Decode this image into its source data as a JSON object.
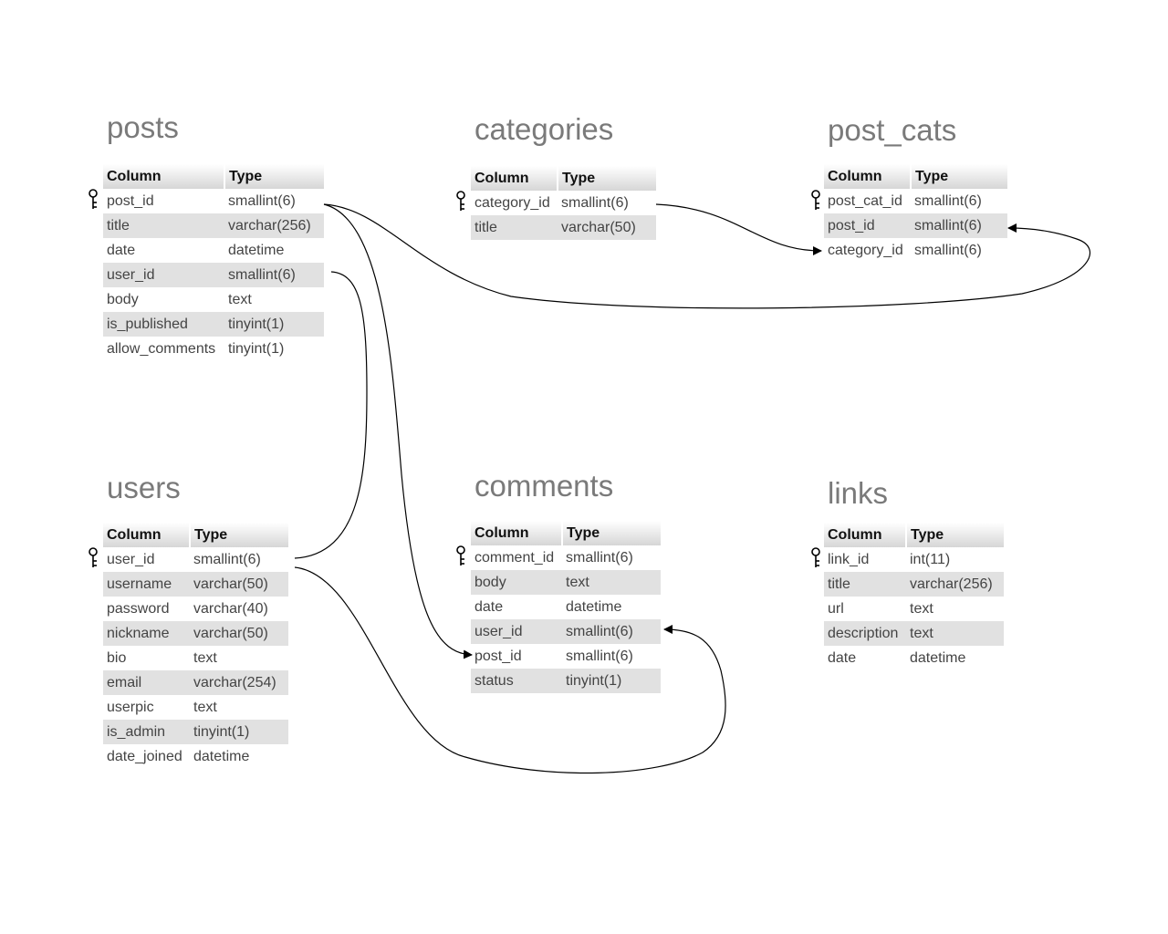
{
  "tables": {
    "posts": {
      "name": "posts",
      "headers": [
        "Column",
        "Type"
      ],
      "rows": [
        [
          "post_id",
          "smallint(6)"
        ],
        [
          "title",
          "varchar(256)"
        ],
        [
          "date",
          "datetime"
        ],
        [
          "user_id",
          "smallint(6)"
        ],
        [
          "body",
          "text"
        ],
        [
          "is_published",
          "tinyint(1)"
        ],
        [
          "allow_comments",
          "tinyint(1)"
        ]
      ]
    },
    "categories": {
      "name": "categories",
      "headers": [
        "Column",
        "Type"
      ],
      "rows": [
        [
          "category_id",
          "smallint(6)"
        ],
        [
          "title",
          "varchar(50)"
        ]
      ]
    },
    "post_cats": {
      "name": "post_cats",
      "headers": [
        "Column",
        "Type"
      ],
      "rows": [
        [
          "post_cat_id",
          "smallint(6)"
        ],
        [
          "post_id",
          "smallint(6)"
        ],
        [
          "category_id",
          "smallint(6)"
        ]
      ]
    },
    "users": {
      "name": "users",
      "headers": [
        "Column",
        "Type"
      ],
      "rows": [
        [
          "user_id",
          "smallint(6)"
        ],
        [
          "username",
          "varchar(50)"
        ],
        [
          "password",
          "varchar(40)"
        ],
        [
          "nickname",
          "varchar(50)"
        ],
        [
          "bio",
          "text"
        ],
        [
          "email",
          "varchar(254)"
        ],
        [
          "userpic",
          "text"
        ],
        [
          "is_admin",
          "tinyint(1)"
        ],
        [
          "date_joined",
          "datetime"
        ]
      ]
    },
    "comments": {
      "name": "comments",
      "headers": [
        "Column",
        "Type"
      ],
      "rows": [
        [
          "comment_id",
          "smallint(6)"
        ],
        [
          "body",
          "text"
        ],
        [
          "date",
          "datetime"
        ],
        [
          "user_id",
          "smallint(6)"
        ],
        [
          "post_id",
          "smallint(6)"
        ],
        [
          "status",
          "tinyint(1)"
        ]
      ]
    },
    "links": {
      "name": "links",
      "headers": [
        "Column",
        "Type"
      ],
      "rows": [
        [
          "link_id",
          "int(11)"
        ],
        [
          "title",
          "varchar(256)"
        ],
        [
          "url",
          "text"
        ],
        [
          "description",
          "text"
        ],
        [
          "date",
          "datetime"
        ]
      ]
    }
  },
  "relations": [
    {
      "from": "posts.post_id",
      "to": "post_cats.post_id"
    },
    {
      "from": "posts.post_id",
      "to": "comments.post_id"
    },
    {
      "from": "categories.category_id",
      "to": "post_cats.category_id"
    },
    {
      "from": "users.user_id",
      "to": "posts.user_id"
    },
    {
      "from": "users.user_id",
      "to": "comments.user_id"
    }
  ],
  "key_icon": "primary-key-icon"
}
